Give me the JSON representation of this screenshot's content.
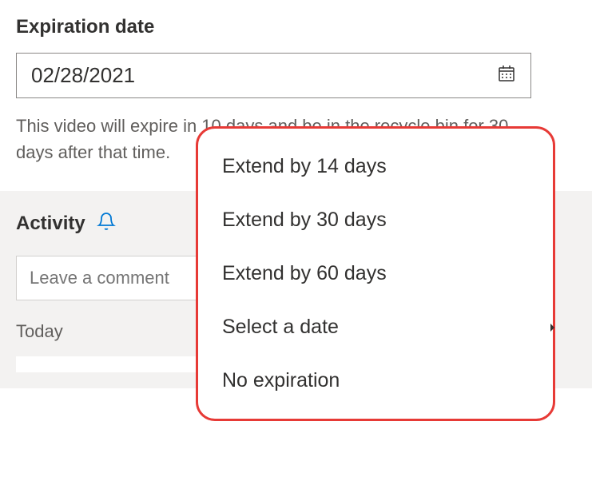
{
  "expiration": {
    "label": "Expiration date",
    "value": "02/28/2021",
    "helper_text": "This video will expire in 10 days and be in the recycle bin for 30 days after that time."
  },
  "dropdown": {
    "items": [
      {
        "label": "Extend by 14 days",
        "has_submenu": false
      },
      {
        "label": "Extend by 30 days",
        "has_submenu": false
      },
      {
        "label": "Extend by 60 days",
        "has_submenu": false
      },
      {
        "label": "Select a date",
        "has_submenu": true
      },
      {
        "label": "No expiration",
        "has_submenu": false
      }
    ]
  },
  "activity": {
    "title": "Activity",
    "comment_placeholder": "Leave a comment",
    "today_label": "Today"
  }
}
